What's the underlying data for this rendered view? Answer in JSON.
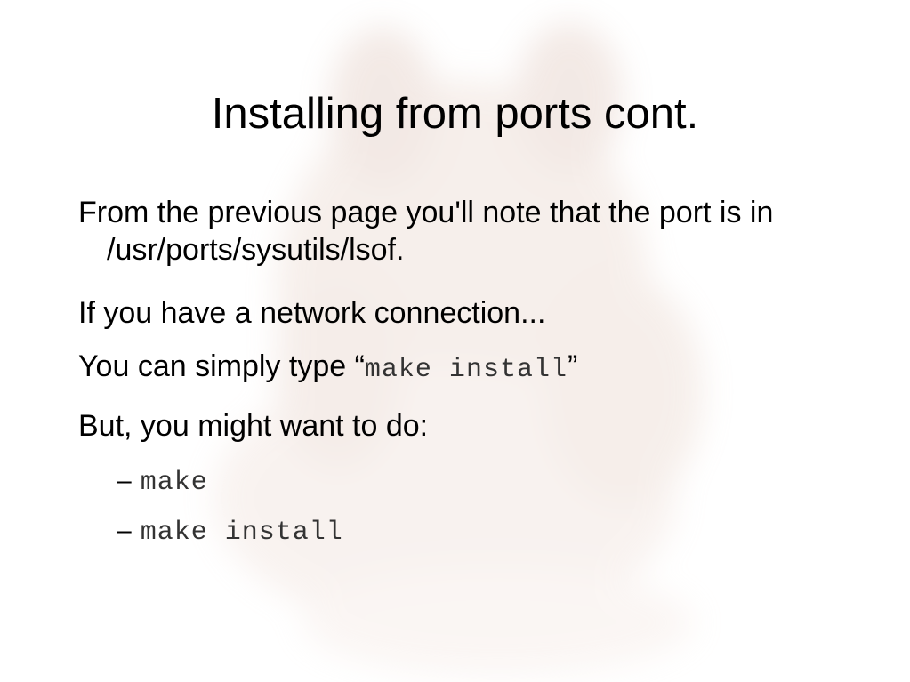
{
  "slide": {
    "title": "Installing from ports cont.",
    "bullets": [
      {
        "text": "From the previous page you'll note that the port is in /usr/ports/sysutils/lsof."
      },
      {
        "text": "If you have a network connection..."
      },
      {
        "prefix": "You can simply type ",
        "open_quote": "“",
        "code": "make install",
        "close_quote": "”"
      },
      {
        "text": "But, you might want to do:"
      }
    ],
    "sub_bullets": [
      {
        "dash": "–",
        "code": "make"
      },
      {
        "dash": "–",
        "code": "make install"
      }
    ]
  }
}
